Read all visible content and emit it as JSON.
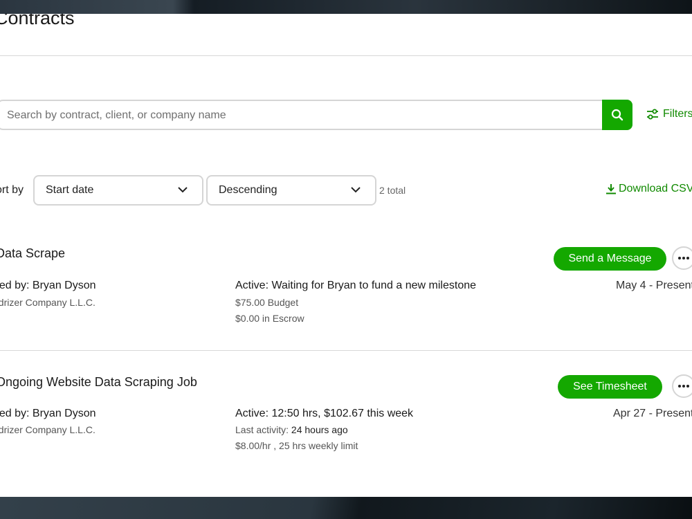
{
  "page": {
    "title": "Contracts"
  },
  "search": {
    "placeholder": "Search by contract, client, or company name"
  },
  "filters_label": "Filters",
  "sort": {
    "label": "ort by",
    "field_value": "Start date",
    "order_value": "Descending",
    "total": "2 total"
  },
  "download_label": "Download CSV",
  "contracts": [
    {
      "title": "Data Scrape",
      "hired_by": "ired by: Bryan Dyson",
      "company": "edrizer Company L.L.C.",
      "status": "Active: Waiting for Bryan to fund a new milestone",
      "line1": "$75.00 Budget",
      "line2": "$0.00 in Escrow",
      "date": "May 4 - Present",
      "action": "Send a Message"
    },
    {
      "title": "Ongoing Website Data Scraping Job",
      "hired_by": "ired by: Bryan Dyson",
      "company": "edrizer Company L.L.C.",
      "status": "Active: 12:50 hrs, $102.67 this week",
      "line1_label": "Last activity:",
      "line1_value": "24 hours ago",
      "line2": "$8.00/hr , 25 hrs weekly limit",
      "date": "Apr 27 - Present",
      "action": "See Timesheet"
    }
  ],
  "colors": {
    "accent": "#14a800",
    "link": "#108a00"
  }
}
